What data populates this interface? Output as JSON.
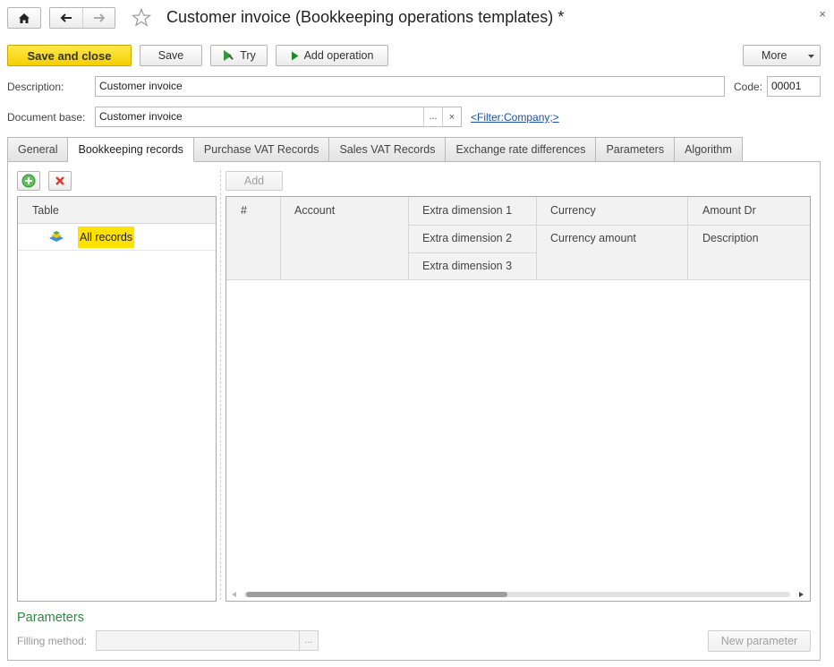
{
  "window": {
    "title": "Customer invoice (Bookkeeping operations templates) *",
    "close_glyph": "×"
  },
  "toolbar": {
    "save_close": "Save and close",
    "save": "Save",
    "try": "Try",
    "add_operation": "Add operation",
    "more": "More"
  },
  "form": {
    "description_label": "Description:",
    "description_value": "Customer invoice",
    "code_label": "Code:",
    "code_value": "00001",
    "docbase_label": "Document base:",
    "docbase_value": "Customer invoice",
    "docbase_select": "...",
    "docbase_clear": "×",
    "filter_link": "<Filter:Company;>"
  },
  "tabs": [
    {
      "label": "General"
    },
    {
      "label": "Bookkeeping records"
    },
    {
      "label": "Purchase VAT Records"
    },
    {
      "label": "Sales VAT Records"
    },
    {
      "label": "Exchange rate differences"
    },
    {
      "label": "Parameters"
    },
    {
      "label": "Algorithm"
    }
  ],
  "left_table": {
    "header": "Table",
    "rows": [
      {
        "label": "All records"
      }
    ]
  },
  "records": {
    "add_button": "Add",
    "columns": {
      "num": "#",
      "account": "Account",
      "extra1": "Extra dimension 1",
      "extra2": "Extra dimension 2",
      "extra3": "Extra dimension 3",
      "currency": "Currency",
      "currency_amount": "Currency amount",
      "amount_dr": "Amount Dr",
      "description": "Description"
    }
  },
  "parameters": {
    "title": "Parameters",
    "filling_label": "Filling method:",
    "filling_value": "",
    "filling_select": "...",
    "new_parameter": "New parameter"
  },
  "colors": {
    "accent_yellow": "#f4cf00",
    "parameters_green": "#2a8a3e",
    "link_blue": "#1a52a8",
    "selection_yellow": "#ffe100"
  }
}
